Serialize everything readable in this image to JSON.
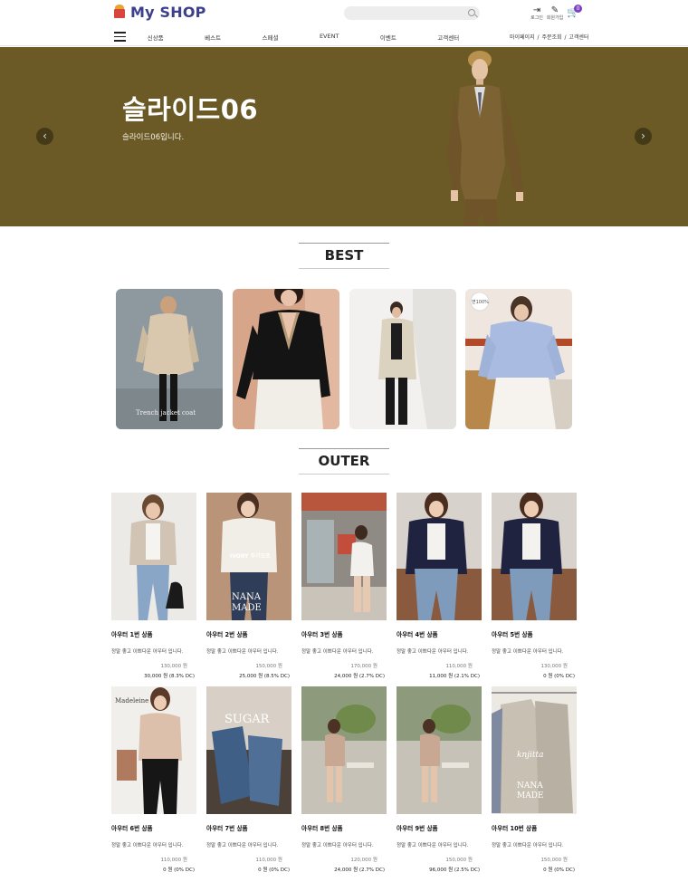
{
  "header": {
    "logo_text": "My SHOP",
    "login_label": "로그인",
    "signup_label": "회원가입",
    "cart_count": "0"
  },
  "nav": {
    "items": [
      "신상품",
      "베스트",
      "스페셜",
      "EVENT",
      "이벤트",
      "고객센터"
    ],
    "util": [
      "마이페이지",
      "주문조회",
      "고객센터"
    ]
  },
  "hero": {
    "title": "슬라이드06",
    "subtitle": "슬라이드06입니다.",
    "bg_color": "#6b5a26"
  },
  "best": {
    "title": "BEST",
    "items": [
      {
        "caption": "Trench jacket coat"
      },
      {
        "caption": ""
      },
      {
        "caption": ""
      },
      {
        "caption": "면100%"
      }
    ]
  },
  "outer": {
    "title": "OUTER",
    "products": [
      {
        "name": "아우터 1번 상품",
        "desc": "정말 좋고 이쁘다운 아우터 입니다.",
        "price": "130,000 원",
        "sale": "30,000 원 (8.3% DC)"
      },
      {
        "name": "아우터 2번 상품",
        "desc": "정말 좋고 이쁘다운 아우터 입니다.",
        "price": "150,000 원",
        "sale": "25,000 원 (8.5% DC)"
      },
      {
        "name": "아우터 3번 상품",
        "desc": "정말 좋고 이쁘다운 아우터 입니다.",
        "price": "170,000 원",
        "sale": "24,000 원 (2.7% DC)"
      },
      {
        "name": "아우터 4번 상품",
        "desc": "정말 좋고 이쁘다운 아우터 입니다.",
        "price": "110,000 원",
        "sale": "11,000 원 (2.1% DC)"
      },
      {
        "name": "아우터 5번 상품",
        "desc": "정말 좋고 이쁘다운 아우터 입니다.",
        "price": "130,000 원",
        "sale": "0 원 (0% DC)"
      },
      {
        "name": "아우터 6번 상품",
        "desc": "정말 좋고 이쁘다운 아우터 입니다.",
        "price": "110,000 원",
        "sale": "0 원 (0% DC)"
      },
      {
        "name": "아우터 7번 상품",
        "desc": "정말 좋고 이쁘다운 아우터 입니다.",
        "price": "110,000 원",
        "sale": "0 원 (0% DC)"
      },
      {
        "name": "아우터 8번 상품",
        "desc": "정말 좋고 이쁘다운 아우터 입니다.",
        "price": "120,000 원",
        "sale": "24,000 원 (2.7% DC)"
      },
      {
        "name": "아우터 9번 상품",
        "desc": "정말 좋고 이쁘다운 아우터 입니다.",
        "price": "150,000 원",
        "sale": "96,000 원 (2.5% DC)"
      },
      {
        "name": "아우터 10번 상품",
        "desc": "정말 좋고 이쁘다운 아우터 입니다.",
        "price": "150,000 원",
        "sale": "0 원 (0% DC)"
      }
    ]
  }
}
